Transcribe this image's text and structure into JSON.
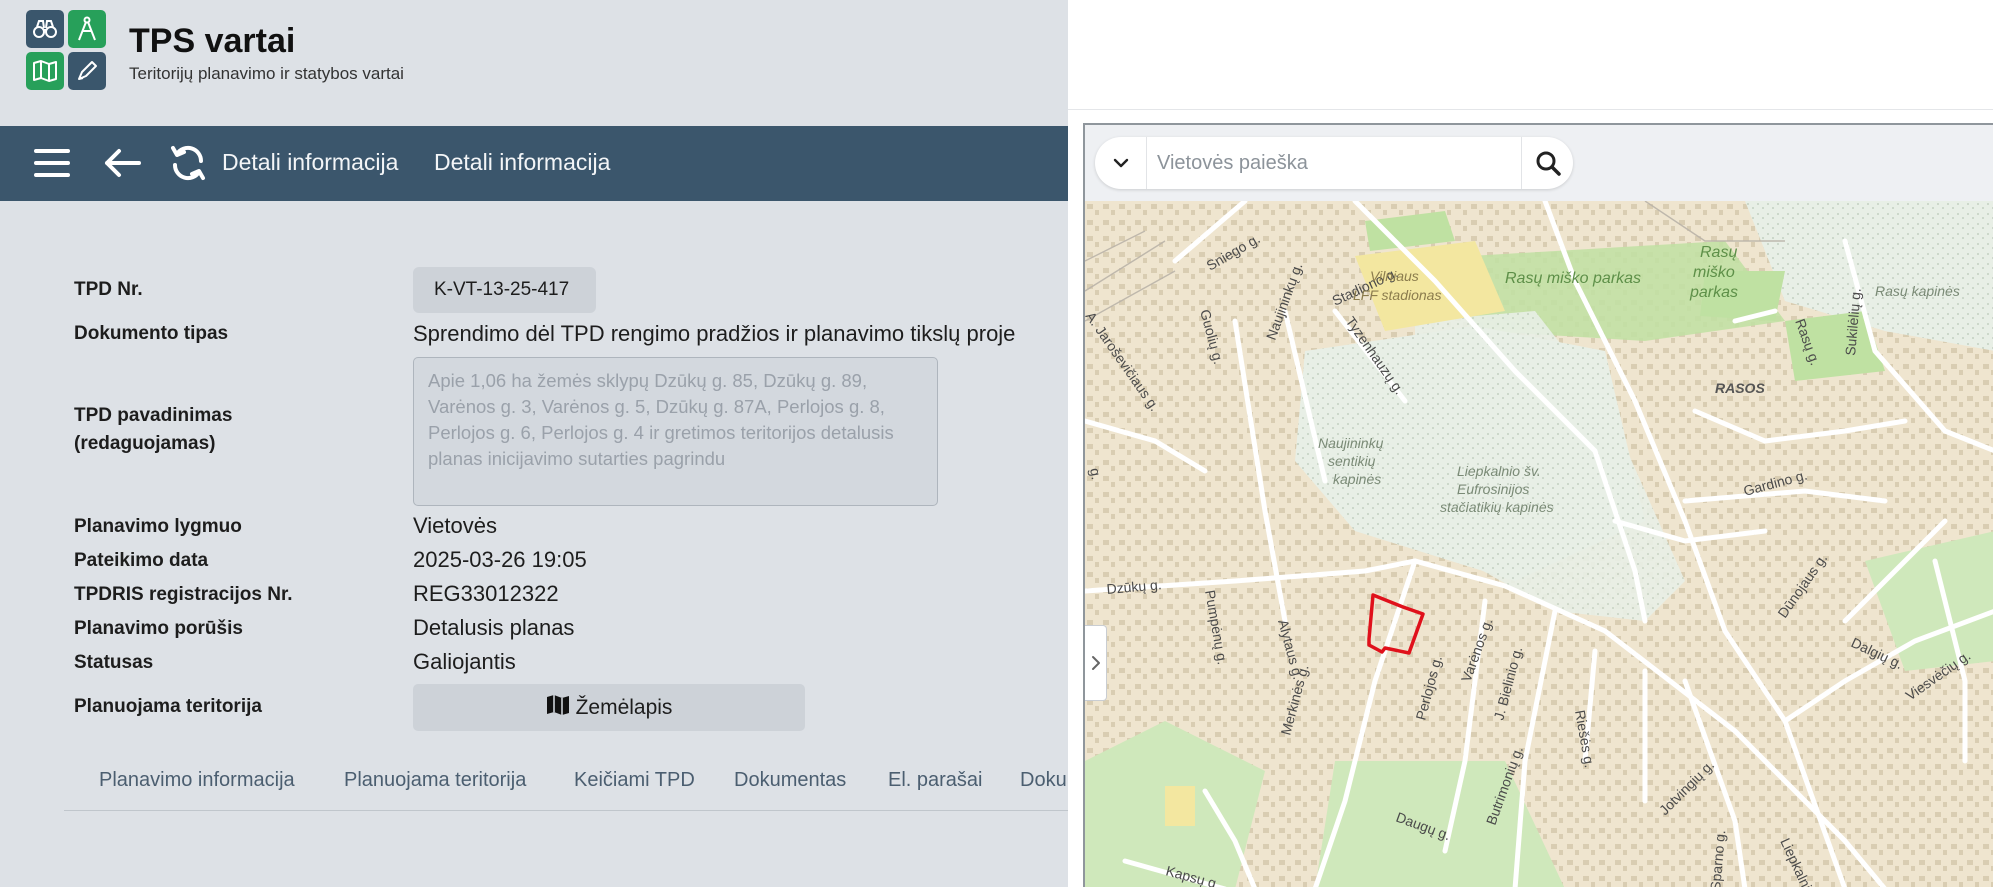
{
  "app": {
    "title": "TPS vartai",
    "subtitle": "Teritorijų planavimo ir statybos vartai"
  },
  "toolbar": {
    "title_1": "Detali informacija",
    "title_2": "Detali informacija"
  },
  "details": {
    "tpd_nr_label": "TPD Nr.",
    "tpd_nr_value": "K-VT-13-25-417",
    "doc_type_label": "Dokumento tipas",
    "doc_type_value": "Sprendimo dėl TPD rengimo pradžios ir planavimo tikslų proje",
    "tpd_name_label_1": "TPD pavadinimas",
    "tpd_name_label_2": "(redaguojamas)",
    "tpd_name_value": "Apie 1,06 ha žemės sklypų Dzūkų g. 85, Dzūkų g. 89, Varėnos g. 3, Varėnos g. 5, Dzūkų g. 87A, Perlojos g. 8, Perlojos g. 6, Perlojos g. 4 ir gretimos teritorijos detalusis planas inicijavimo sutarties pagrindu",
    "level_label": "Planavimo lygmuo",
    "level_value": "Vietovės",
    "date_label": "Pateikimo data",
    "date_value": "2025-03-26 19:05",
    "reg_label": "TPDRIS registracijos Nr.",
    "reg_value": "REG33012322",
    "type_label": "Planavimo porūšis",
    "type_value": "Detalusis planas",
    "status_label": "Statusas",
    "status_value": "Galiojantis",
    "territory_label": "Planuojama teritorija",
    "map_button": "Žemėlapis"
  },
  "tabs": [
    "Planavimo informacija",
    "Planuojama teritorija",
    "Keičiami TPD",
    "Dokumentas",
    "El. parašai",
    "Doku"
  ],
  "map": {
    "search_placeholder": "Vietovės paieška",
    "labels": {
      "sniego": "Sniego g.",
      "stadiono": "Stadiono g.",
      "vilniaus_1": "Vilniaus",
      "vilniaus_2": "LFF stadionas",
      "rasu_parkas": "Rasų miško parkas",
      "rasu_mp_1": "Rasų",
      "rasu_mp_2": "miško",
      "rasu_mp_3": "parkas",
      "rasu_kapines": "Rasų kapinės",
      "jaroseviciaus": "A. Jaroševičiaus g.",
      "guoliu": "Guolių g.",
      "naujininku": "Naujininkų g.",
      "tyzenhauzu": "Tyzenhauzų g.",
      "sukileliu": "Sukilėlių g.",
      "rasos": "RASOS",
      "rasu_g": "Rasų g.",
      "nauj_kap_1": "Naujininkų",
      "nauj_kap_2": "sentikių",
      "nauj_kap_3": "kapinės",
      "liep_kap_1": "Liepkalnio šv.",
      "liep_kap_2": "Eufrosinijos",
      "liep_kap_3": "stačiatikių kapinės",
      "gardino": "Gardino g.",
      "dzuku": "Dzūkų g.",
      "pumpenu": "Pumpėnų g.",
      "alytaus": "Alytaus g.",
      "merkines": "Merkinės g.",
      "perlojos": "Perlojos g.",
      "varenos": "Varėnos g.",
      "bielinio": "J. Bielinio g.",
      "rieses": "Riešės g.",
      "dzukijos": "Dūnojaus g.",
      "dalgiu": "Dalgių g.",
      "viesvieciu": "Viesvėčių g.",
      "jotvingiu": "Jotvingių g.",
      "butrimoniu": "Butrimonių g.",
      "daugu": "Daugų g.",
      "liepkalnio": "Liepkalnio g.",
      "kapsu": "Kapsų g.",
      "sparno": "Sparno g.",
      "rag": "g."
    }
  },
  "colors": {
    "toolbar_bg": "#3b566c",
    "page_bg": "#dde1e6",
    "parcel_outline": "#e0111b",
    "logo_dark": "#3a566c",
    "logo_green": "#27a05a"
  },
  "icons": [
    "binoculars-icon",
    "compass-icon",
    "map-icon",
    "pen-icon",
    "menu-icon",
    "back-arrow-icon",
    "refresh-icon",
    "map-button-icon",
    "chevron-down-icon",
    "search-icon",
    "chevron-right-icon"
  ]
}
